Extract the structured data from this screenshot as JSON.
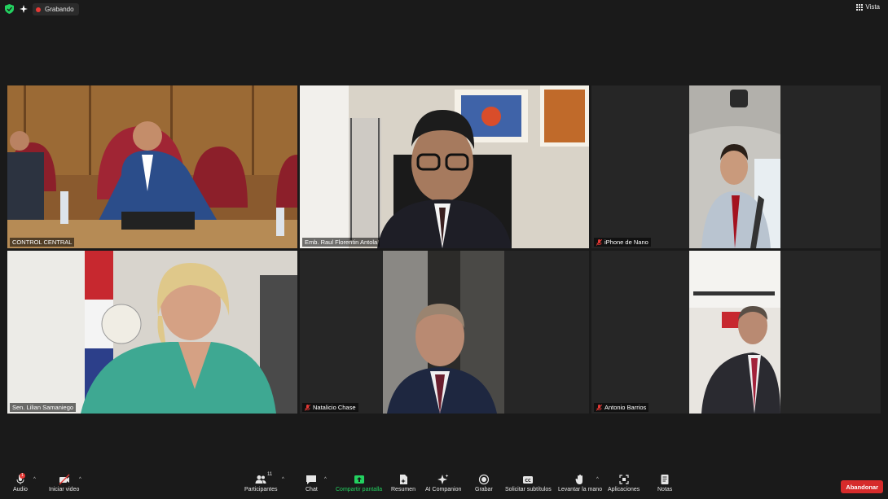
{
  "topbar": {
    "recording_label": "Grabando",
    "view_label": "Vista"
  },
  "tiles": [
    {
      "name": "CONTROL CENTRAL",
      "muted": false,
      "active": true
    },
    {
      "name": "Emb. Raul Florentin Antola",
      "muted": false,
      "active": false
    },
    {
      "name": "iPhone de Nano",
      "muted": true,
      "active": false
    },
    {
      "name": "Sen. Lilian Samaniego",
      "muted": false,
      "active": false
    },
    {
      "name": "Natalicio Chase",
      "muted": true,
      "active": false
    },
    {
      "name": "Antonio Barrios",
      "muted": true,
      "active": false
    }
  ],
  "toolbar": {
    "audio_label": "Audio",
    "video_label": "Iniciar video",
    "participants_label": "Participantes",
    "participants_count": "11",
    "chat_label": "Chat",
    "share_label": "Compartir pantalla",
    "summary_label": "Resumen",
    "companion_label": "AI Companion",
    "record_label": "Grabar",
    "captions_label": "Solicitar subtítulos",
    "raise_hand_label": "Levantar la mano",
    "apps_label": "Aplicaciones",
    "notes_label": "Notas",
    "leave_label": "Abandonar",
    "audio_badge": "1"
  },
  "colors": {
    "active_speaker": "#e4df3a",
    "share_green": "#23d160",
    "leave_red": "#d62b2b",
    "recording_red": "#e53935"
  }
}
